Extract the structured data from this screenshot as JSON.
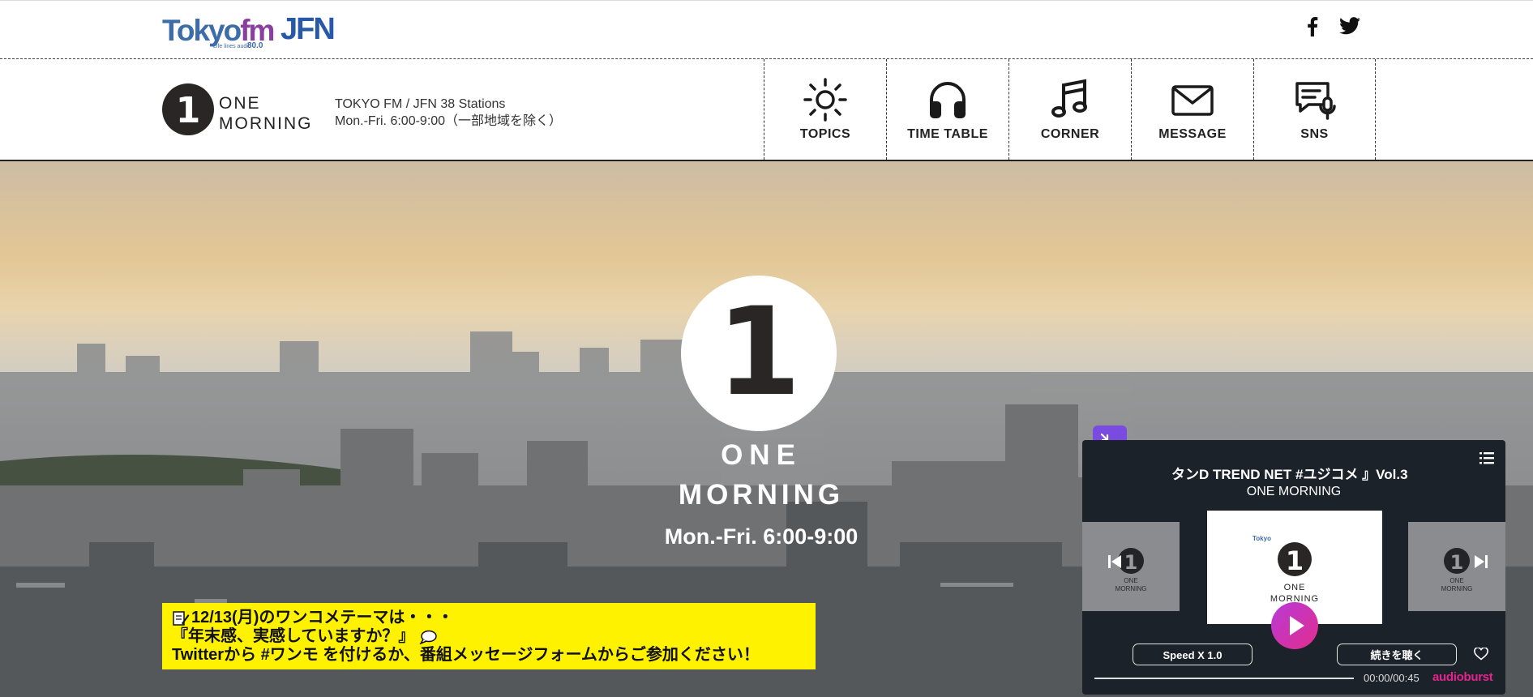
{
  "header": {
    "tokyofm_logo": {
      "part1": "Tokyo",
      "part2": "fm",
      "tagline": "Life lines audio",
      "frequency": "80.0"
    },
    "jfn_logo": "JFN",
    "social": [
      {
        "icon": "facebook-icon"
      },
      {
        "icon": "twitter-icon"
      }
    ]
  },
  "program": {
    "logo_number": "1",
    "logo_line1": "ONE",
    "logo_line2": "MORNING",
    "stations": "TOKYO FM / JFN 38 Stations",
    "schedule": "Mon.-Fri. 6:00-9:00（一部地域を除く）"
  },
  "nav": [
    {
      "label": "TOPICS",
      "icon": "sun-icon"
    },
    {
      "label": "TIME TABLE",
      "icon": "headphones-icon"
    },
    {
      "label": "CORNER",
      "icon": "music-note-icon"
    },
    {
      "label": "MESSAGE",
      "icon": "envelope-icon"
    },
    {
      "label": "SNS",
      "icon": "chat-mic-icon"
    }
  ],
  "hero": {
    "badge_number": "1",
    "line1": "ONE",
    "line2": "MORNING",
    "time": "Mon.-Fri. 6:00-9:00"
  },
  "announcement": {
    "line1": "12/13(月)のワンコメテーマは・・・",
    "line2": "『年末感、実感していますか？』",
    "line3": "Twitterから #ワンモ を付けるか、番組メッセージフォームからご参加ください！"
  },
  "player": {
    "episode_title": "タンD TREND NET #ユジコメ 』Vol.3",
    "show_name": "ONE MORNING",
    "thumb_line1": "ONE",
    "thumb_line2": "MORNING",
    "speed_label": "Speed X 1.0",
    "continue_label": "続きを聴く",
    "elapsed": "00:00",
    "duration": "00:45",
    "time_display": "00:00/00:45",
    "progress": 0,
    "brand": "audioburst",
    "colors": {
      "accent": "#7a4be0",
      "play_gradient_start": "#b83ad9",
      "play_gradient_end": "#e22d8c",
      "brand": "#e3248e",
      "panel": "#1c2229"
    }
  }
}
